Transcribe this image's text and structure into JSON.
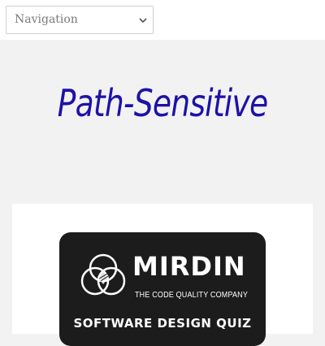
{
  "navigation": {
    "selected": "Navigation",
    "chevron_icon": "chevron-down-icon"
  },
  "site": {
    "title": "Path-Sensitive",
    "title_color": "#1d12a6"
  },
  "banner": {
    "logo_icon": "venn-circles-logo-icon",
    "brand_name": "MIRDIN",
    "tagline": "THE CODE QUALITY COMPANY",
    "quiz_title": "SOFTWARE DESIGN QUIZ",
    "background_color": "#1c1c1c"
  }
}
